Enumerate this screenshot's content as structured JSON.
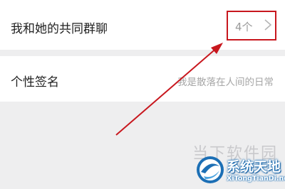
{
  "groups_row": {
    "label": "我和她的共同群聊",
    "count": "4个"
  },
  "signature_row": {
    "label": "个性签名",
    "value": "我是散落在人间的日常"
  },
  "watermark": {
    "ghost_text": "当下软件园",
    "title": "系统天地",
    "subtitle": "XiTongTianDi.net"
  },
  "colors": {
    "background": "#eeeeef",
    "highlight": "#c8171e",
    "watermark_blue": "#1c6fb5"
  },
  "icons": [
    "chevron-right-icon",
    "red-arrow-annotation",
    "watermark-logo-icon"
  ]
}
